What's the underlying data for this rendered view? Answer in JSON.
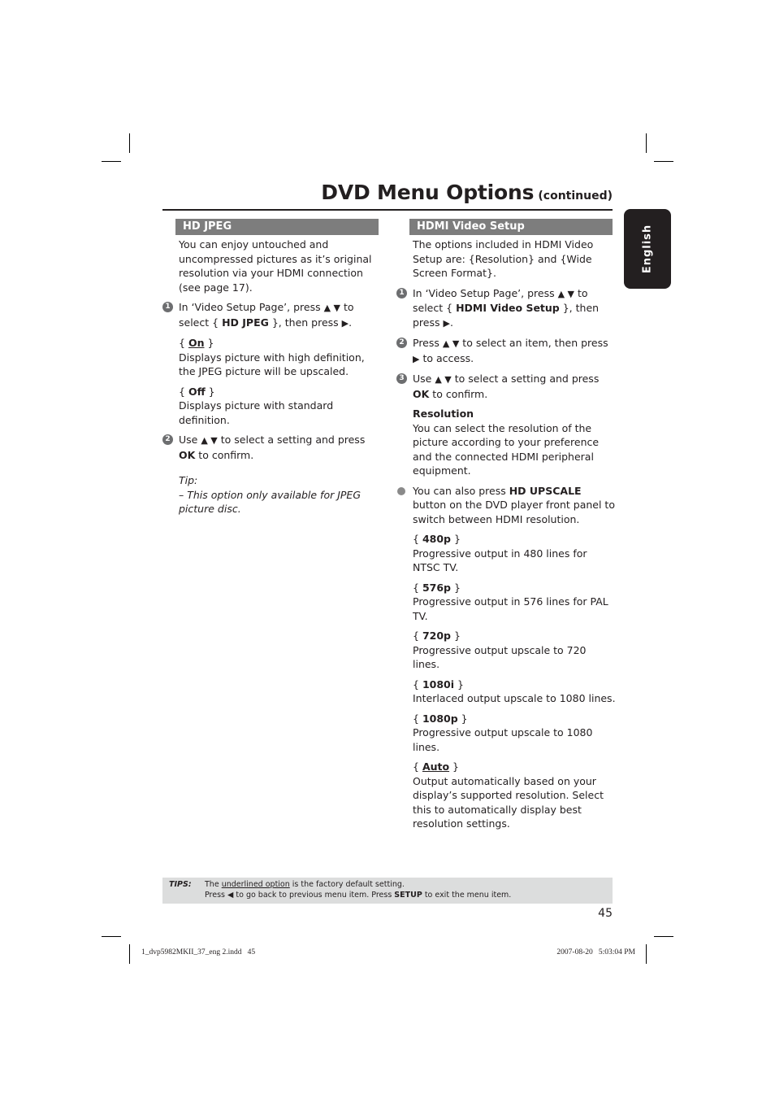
{
  "header": {
    "title": "DVD Menu Options",
    "subtitle": "(continued)"
  },
  "language_tab": "English",
  "left": {
    "heading": "HD JPEG",
    "intro": "You can enjoy untouched and uncompressed pictures as it’s original resolution via your HDMI connection (see page 17).",
    "step1": {
      "num": "1",
      "pre": "In ‘Video Setup Page’, press",
      "arrows": "▲ ▼",
      "mid": "to select {",
      "bold": "HD JPEG",
      "post": "}, then press",
      "end_glyph": "▶",
      "end": "."
    },
    "options": [
      {
        "label": "On",
        "default": true,
        "desc": "Displays picture with high definition, the JPEG picture will be upscaled."
      },
      {
        "label": "Off",
        "default": false,
        "desc": "Displays picture with standard definition."
      }
    ],
    "step2": {
      "num": "2",
      "pre": "Use",
      "arrows": "▲ ▼",
      "mid": "to select a setting and press",
      "bold": "OK",
      "post": "to confirm."
    },
    "tip_label": "Tip:",
    "tip_text": "– This option only available for JPEG picture disc."
  },
  "right": {
    "heading": "HDMI Video Setup",
    "intro": "The options included in HDMI Video Setup are: {Resolution} and {Wide Screen Format}.",
    "step1": {
      "num": "1",
      "pre": "In ‘Video Setup Page’, press",
      "arrows": "▲ ▼",
      "mid": "to select {",
      "bold": "HDMI Video Setup",
      "post": "}, then press",
      "end_glyph": "▶",
      "end": "."
    },
    "step2": {
      "num": "2",
      "pre": "Press",
      "arrows": "▲ ▼",
      "mid": "to select an item, then press",
      "glyph": "▶",
      "post": "to access."
    },
    "step3": {
      "num": "3",
      "pre": "Use",
      "arrows": "▲ ▼",
      "mid": "to select a setting and press",
      "bold": "OK",
      "post": "to confirm."
    },
    "resolution_heading": "Resolution",
    "resolution_text": "You can select the resolution of the picture according to your preference and the connected HDMI peripheral equipment.",
    "bullet": {
      "pre": "You can also press",
      "bold": "HD UPSCALE",
      "post": "button on the DVD player front panel to switch between HDMI resolution."
    },
    "options": [
      {
        "label": "480p",
        "default": false,
        "desc": "Progressive output in 480 lines for NTSC TV."
      },
      {
        "label": "576p",
        "default": false,
        "desc": "Progressive output in 576 lines for PAL TV."
      },
      {
        "label": "720p",
        "default": false,
        "desc": "Progressive output upscale to 720 lines."
      },
      {
        "label": "1080i",
        "default": false,
        "desc": "Interlaced output upscale to 1080 lines."
      },
      {
        "label": "1080p",
        "default": false,
        "desc": "Progressive output upscale to 1080 lines."
      },
      {
        "label": "Auto",
        "default": true,
        "desc": "Output automatically based on your display’s supported resolution. Select this to automatically display best resolution settings."
      }
    ]
  },
  "tips": {
    "label": "TIPS:",
    "line1_pre": "The",
    "line1_underlined": "underlined option",
    "line1_post": "is the factory default setting.",
    "line2_pre": "Press",
    "line2_glyph": "◀",
    "line2_mid": "to go back to previous menu item. Press",
    "line2_bold": "SETUP",
    "line2_post": "to exit the menu item."
  },
  "page_number": "45",
  "slug": {
    "file": "1_dvp5982MKII_37_eng 2.indd   45",
    "timestamp": "2007-08-20   5:03:04 PM"
  }
}
